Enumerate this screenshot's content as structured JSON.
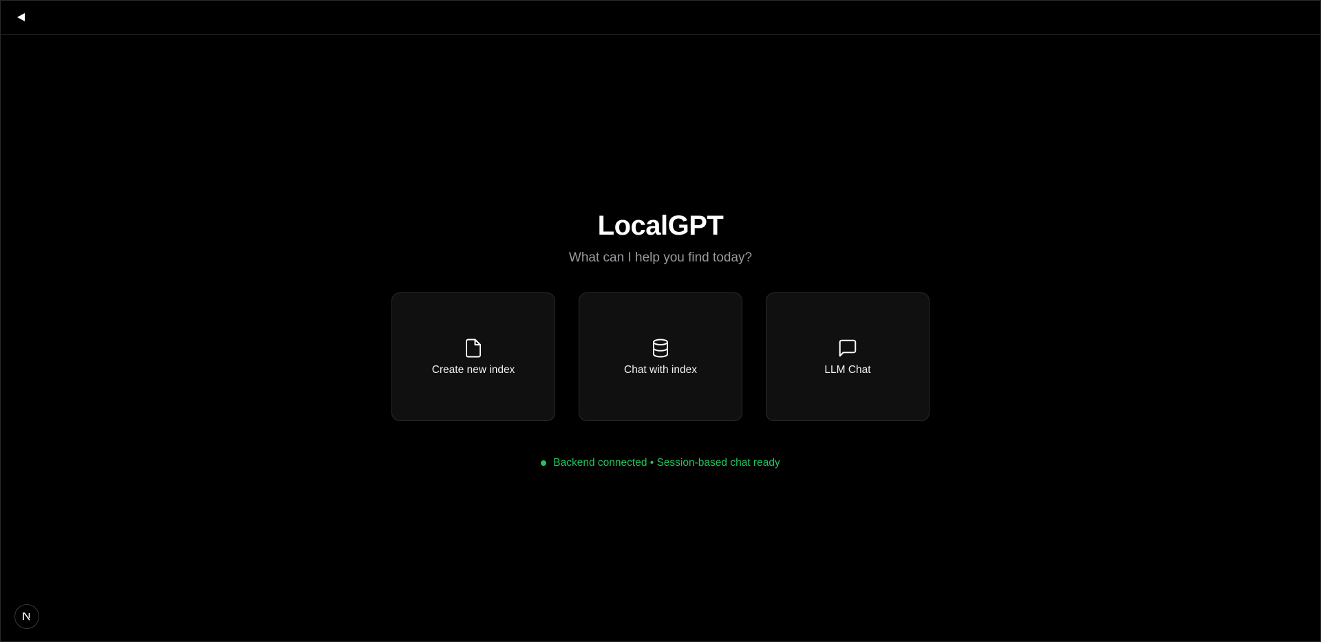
{
  "app": {
    "title": "LocalGPT",
    "subtitle": "What can I help you find today?"
  },
  "topbar": {
    "back_icon": "collapse-left-triangle-icon"
  },
  "cards": [
    {
      "label": "Create new index",
      "icon": "file-icon"
    },
    {
      "label": "Chat with index",
      "icon": "database-icon"
    },
    {
      "label": "LLM Chat",
      "icon": "message-square-icon"
    }
  ],
  "status": {
    "text": "Backend connected • Session-based chat ready",
    "color": "#22c55e"
  },
  "devtools": {
    "icon": "nextjs-logo-icon"
  },
  "colors": {
    "background": "#000000",
    "card_background": "#101010",
    "card_border": "#2b2b2b",
    "subtitle": "#9a9aa0"
  }
}
